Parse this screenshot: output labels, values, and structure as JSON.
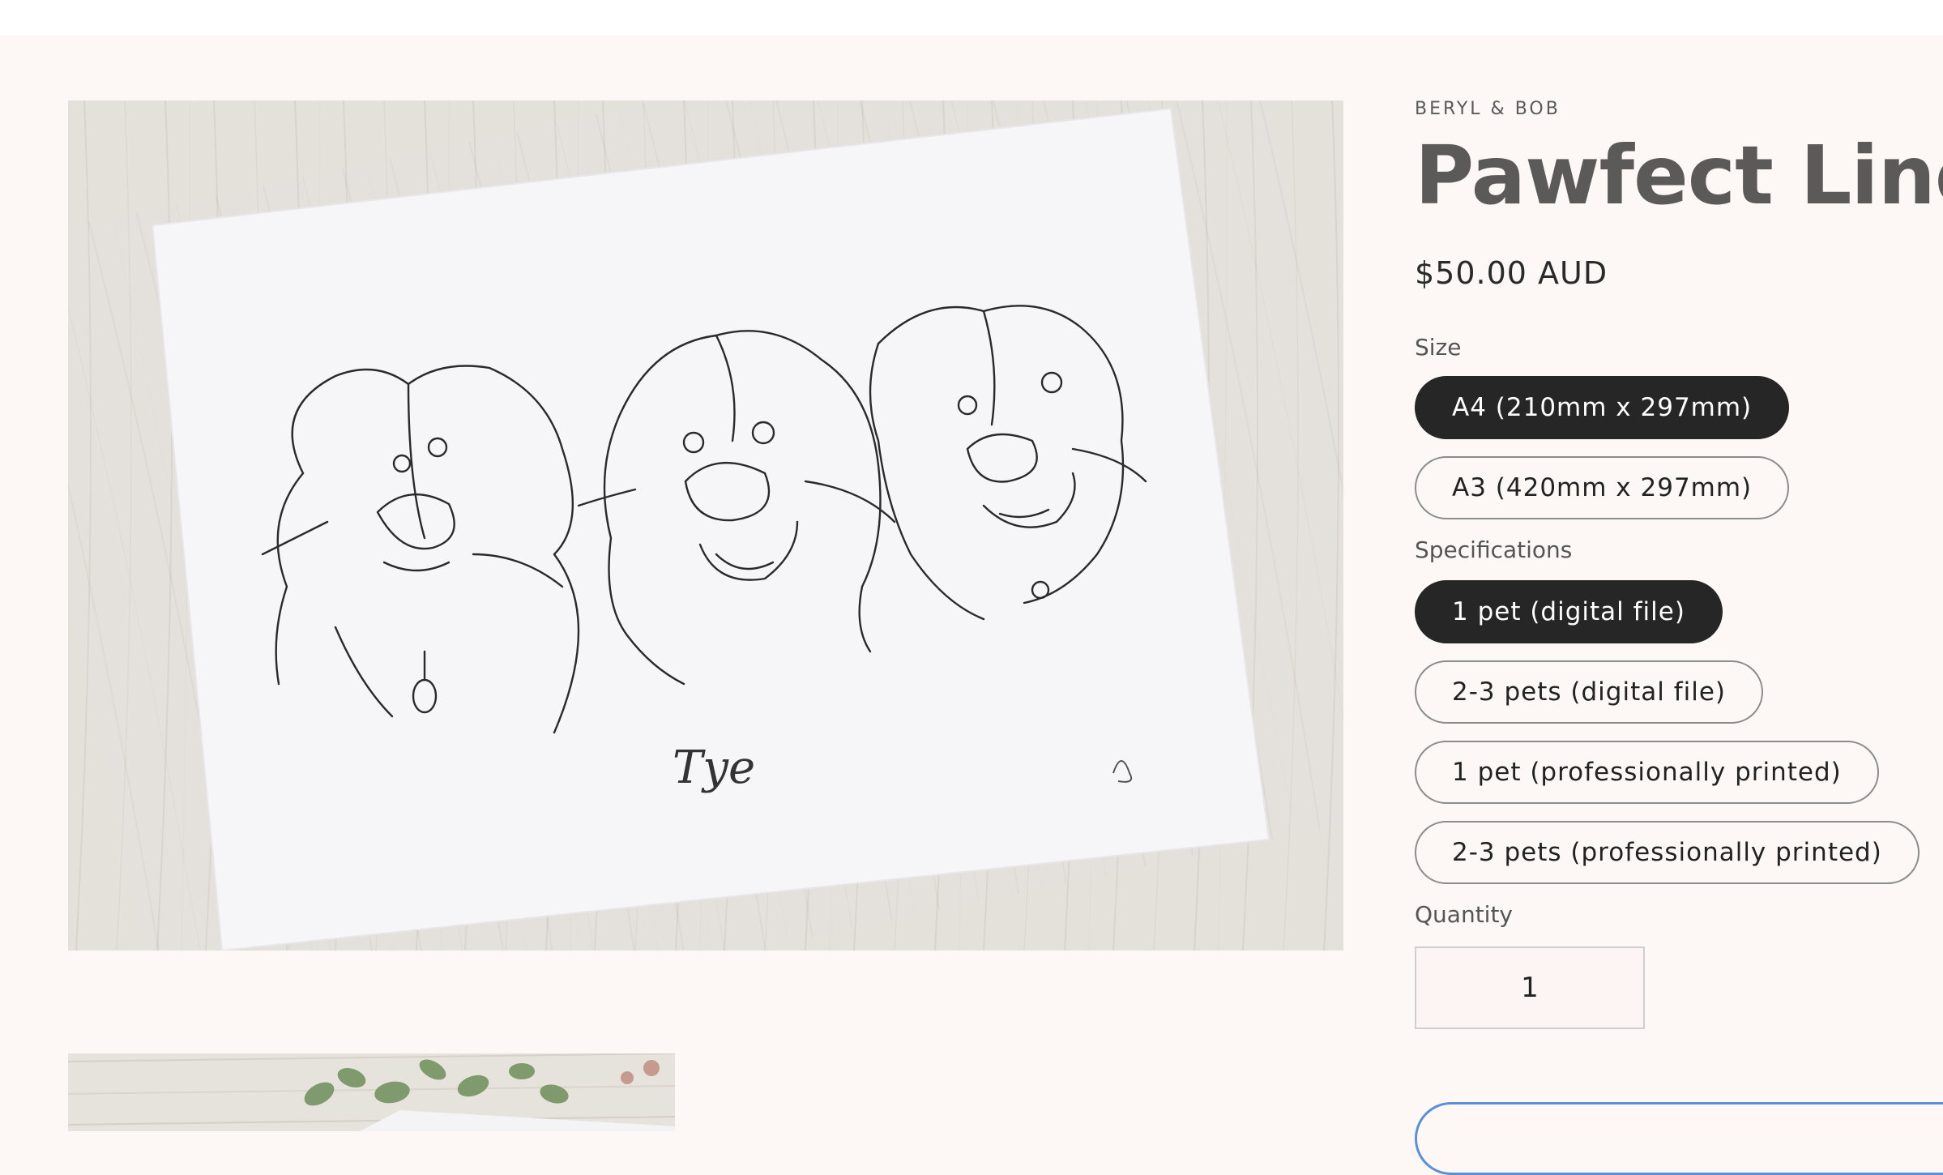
{
  "product": {
    "vendor": "BERYL & BOB",
    "title": "Pawfect Lines",
    "price": "$50.00 AUD"
  },
  "options": {
    "size": {
      "label": "Size",
      "values": [
        "A4 (210mm x 297mm)",
        "A3 (420mm x 297mm)"
      ],
      "selected": "A4 (210mm x 297mm)"
    },
    "specifications": {
      "label": "Specifications",
      "values": [
        "1 pet (digital file)",
        "2-3 pets (digital file)",
        "1 pet (professionally printed)",
        "2-3 pets (professionally printed)"
      ],
      "selected": "1 pet (digital file)"
    }
  },
  "quantity": {
    "label": "Quantity",
    "value": "1"
  },
  "gallery": {
    "main_image": "pet-line-drawing-portrait",
    "signature_text": "Tye",
    "thumbnail": "print-with-eucalyptus"
  },
  "colors": {
    "background": "#fdf8f6",
    "selected_pill": "#262626",
    "title": "#5c5a59",
    "cart_outline": "#5b8fd6"
  }
}
